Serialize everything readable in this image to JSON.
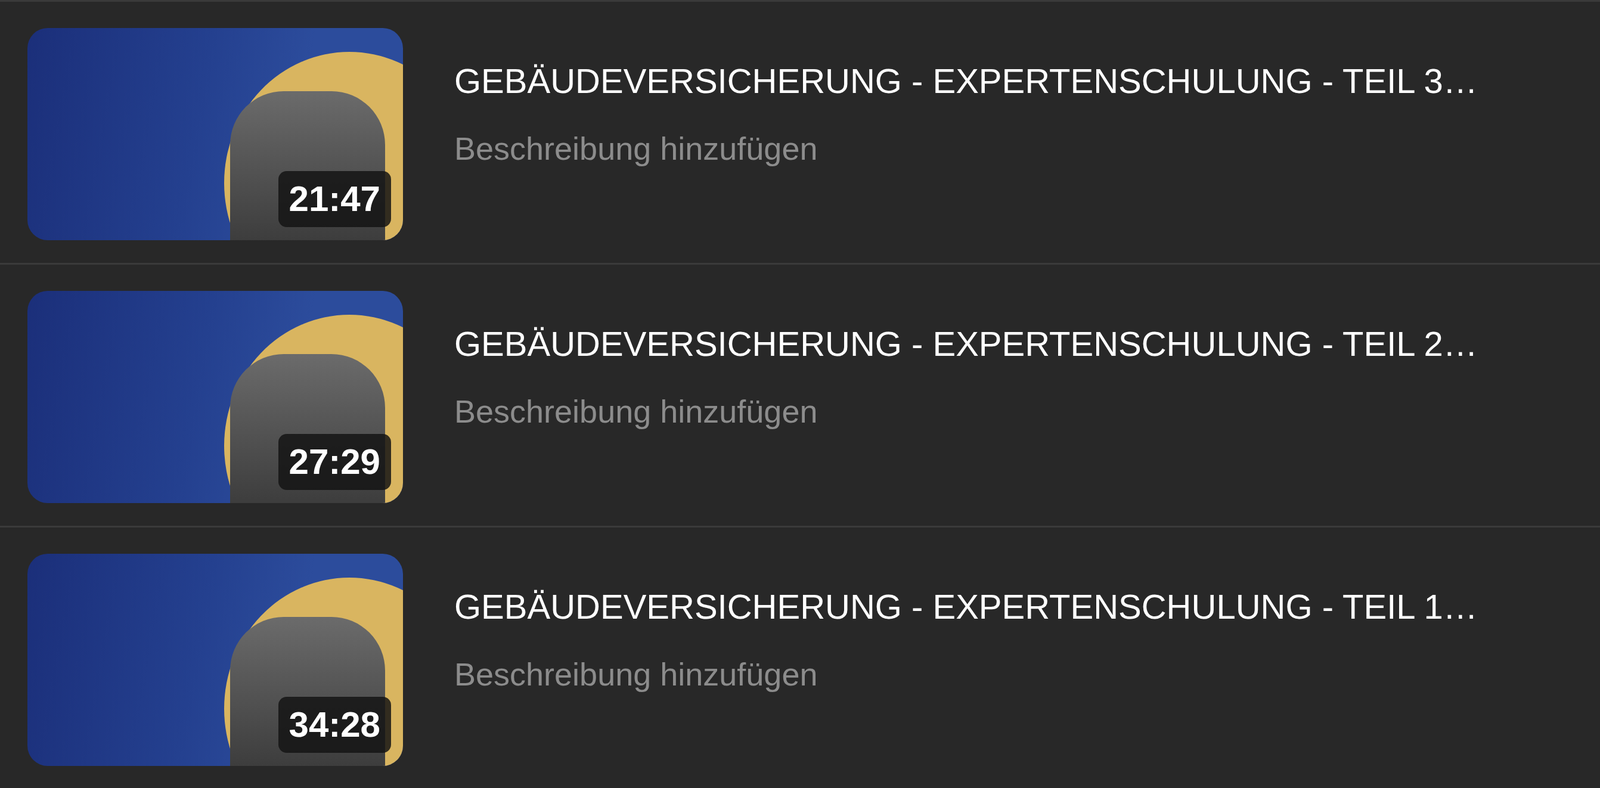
{
  "videos": [
    {
      "title": "GEBÄUDEVERSICHERUNG - EXPERTENSCHULUNG - TEIL 3…",
      "description": "Beschreibung hinzufügen",
      "duration": "21:47"
    },
    {
      "title": "GEBÄUDEVERSICHERUNG - EXPERTENSCHULUNG - TEIL 2…",
      "description": "Beschreibung hinzufügen",
      "duration": "27:29"
    },
    {
      "title": "GEBÄUDEVERSICHERUNG - EXPERTENSCHULUNG - TEIL 1…",
      "description": "Beschreibung hinzufügen",
      "duration": "34:28"
    }
  ]
}
